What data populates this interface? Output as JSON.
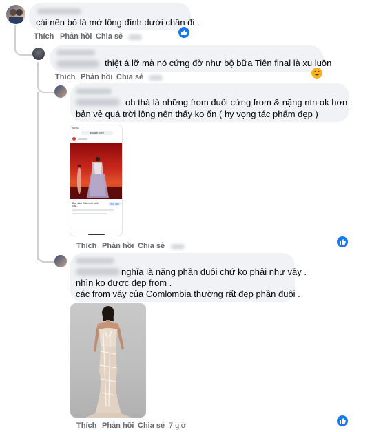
{
  "actions": {
    "like": "Thích",
    "reply": "Phản hồi",
    "share": "Chia sẻ"
  },
  "comments": [
    {
      "text_lines": [
        "cái nên bỏ là mớ lông đính dưới chân đi ."
      ],
      "reaction": "like"
    },
    {
      "text_lines": [
        "thiệt á lỡ mà nó cứng đờ như bộ bữa Tiên final là xu luôn"
      ],
      "reaction": "haha"
    },
    {
      "text_lines": [
        "oh thà là những from đuôi cứng from & nặng ntn ok hơn .",
        "bản vẻ quá trời lông nên thấy ko ổn ( hy vọng tác phẩm đẹp )"
      ],
      "reaction": "like"
    },
    {
      "text_lines": [
        "nghĩa là nặng phần đuôi chứ ko phải như vầy .",
        "nhìn ko được đẹp from .",
        "các from váy của Comlombia thường rất đẹp phần đuôi ."
      ],
      "reaction": "like",
      "timestamp": "7 giờ"
    }
  ],
  "phone_screenshot": {
    "time": "09:53",
    "url": "google.com",
    "caption": "Bạn dâm Colombia tự lộ váy...",
    "button": "Truy cập"
  },
  "colors": {
    "like_blue": "#1877f2",
    "haha_yellow": "#f7b125",
    "bubble_bg": "#f0f2f5",
    "meta_gray": "#65676b"
  },
  "icons": [
    "like-reaction-icon",
    "haha-reaction-icon"
  ]
}
